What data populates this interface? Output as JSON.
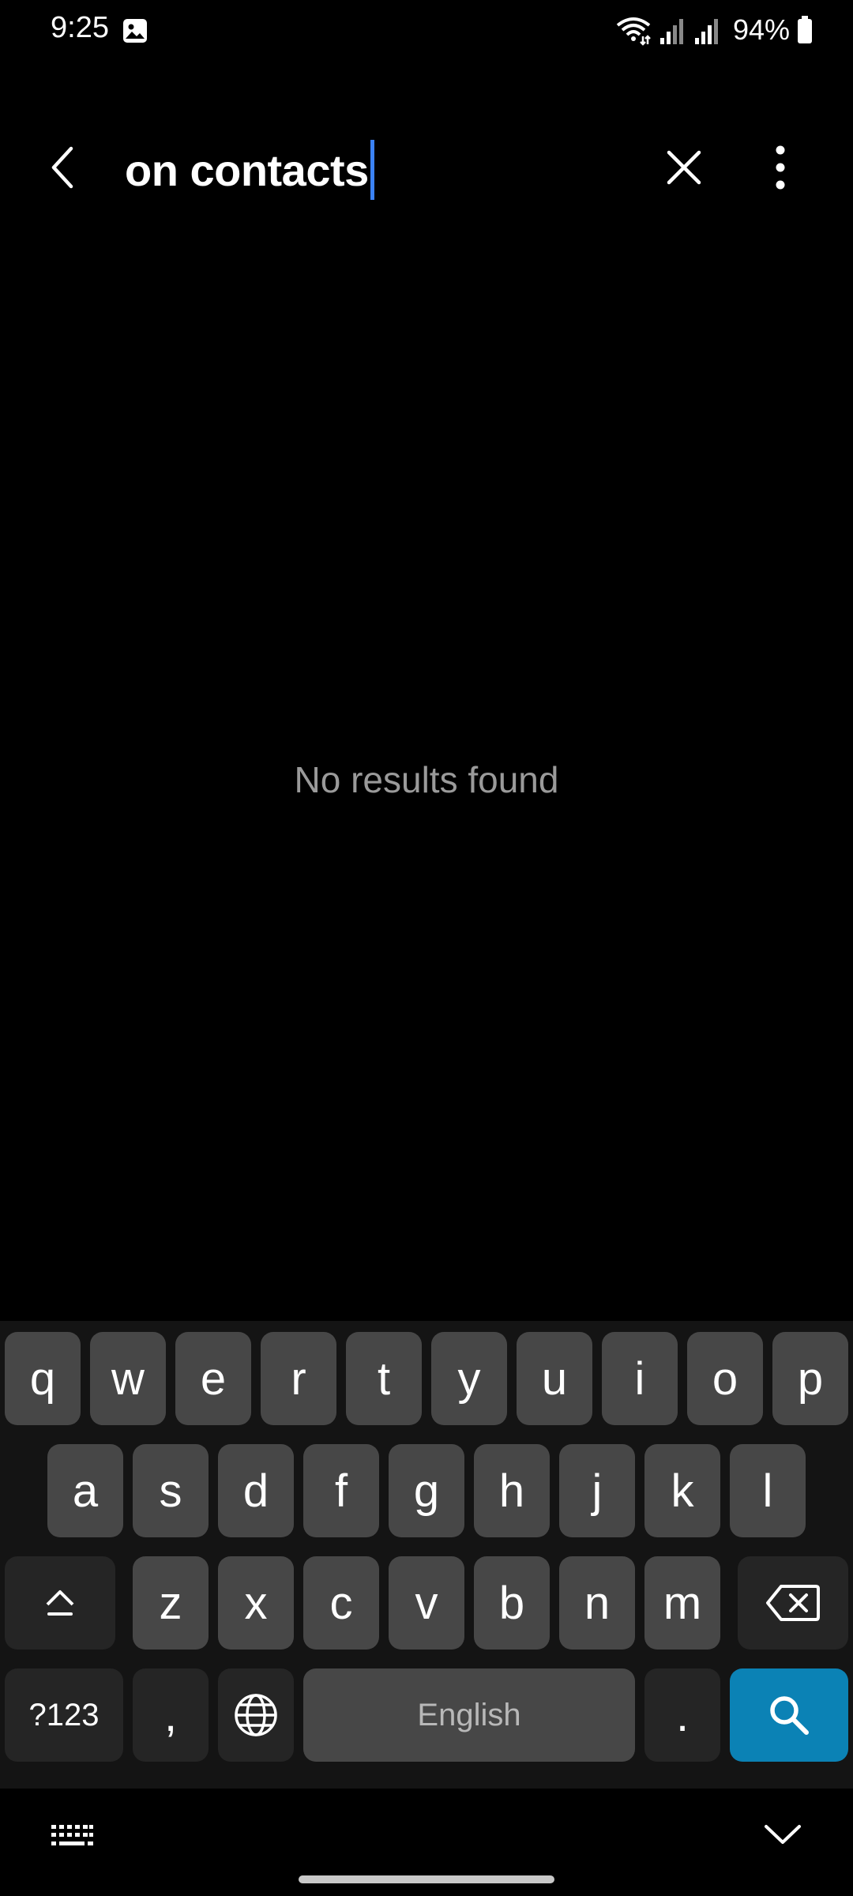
{
  "status_bar": {
    "time": "9:25",
    "battery": "94%",
    "icons": [
      "gallery-icon",
      "wifi-icon",
      "signal-icon",
      "signal-icon",
      "battery-icon"
    ]
  },
  "header": {
    "search_value": "on contacts",
    "icons": {
      "back": "back-arrow-icon",
      "clear": "close-icon",
      "more": "more-vert-icon"
    }
  },
  "results": {
    "empty_message": "No results found"
  },
  "keyboard": {
    "row1": [
      "q",
      "w",
      "e",
      "r",
      "t",
      "y",
      "u",
      "i",
      "o",
      "p"
    ],
    "row2": [
      "a",
      "s",
      "d",
      "f",
      "g",
      "h",
      "j",
      "k",
      "l"
    ],
    "row3": [
      "z",
      "x",
      "c",
      "v",
      "b",
      "n",
      "m"
    ],
    "symbols_label": "?123",
    "comma": ",",
    "space_label": "English",
    "period": ".",
    "icons": {
      "shift": "shift-icon",
      "backspace": "backspace-icon",
      "language": "globe-icon",
      "search": "search-icon",
      "switch": "keyboard-switch-icon",
      "hide": "chevron-down-icon"
    }
  },
  "colors": {
    "background": "#000000",
    "key": "#474747",
    "key_dark": "#252525",
    "accent_search": "#0b82b5",
    "caret": "#3b82f6",
    "muted_text": "#9a9a9a"
  }
}
